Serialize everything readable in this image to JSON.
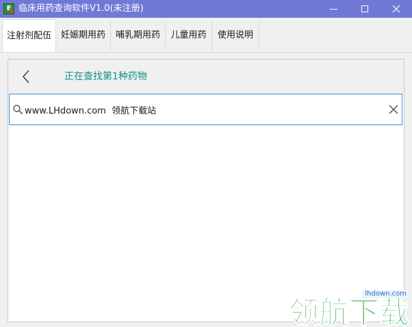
{
  "window": {
    "title": "临床用药查询软件V1.0(未注册)",
    "app_icon_letter": "E"
  },
  "tabs": [
    {
      "label": "注射剂配伍",
      "active": true
    },
    {
      "label": "妊娠期用药",
      "active": false
    },
    {
      "label": "哺乳期用药",
      "active": false
    },
    {
      "label": "儿童用药",
      "active": false
    },
    {
      "label": "使用说明",
      "active": false
    }
  ],
  "search_panel": {
    "status": "正在查找第1种药物",
    "input_value": "www.LHdown.com  领航下载站"
  },
  "watermark": {
    "logo_text": "领航下载",
    "url": "lhdown.com"
  },
  "colors": {
    "titlebar": "#7179d6",
    "accent_teal": "#148f8a",
    "focus_border": "#3a8bd6",
    "watermark_green": "#1fa83a"
  }
}
